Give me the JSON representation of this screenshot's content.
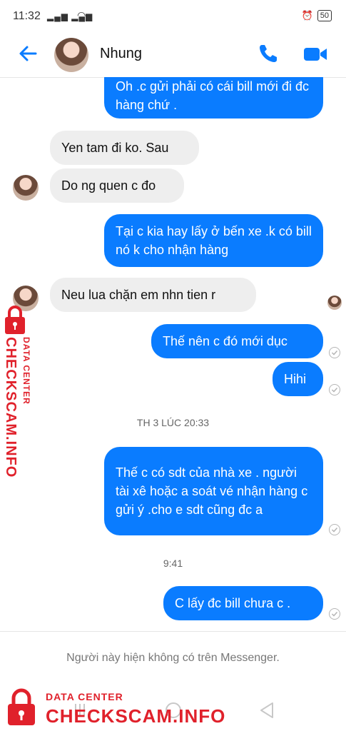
{
  "status_bar": {
    "time": "11:32",
    "battery": "50"
  },
  "header": {
    "contact_name": "Nhung"
  },
  "messages": [
    {
      "side": "out",
      "lines": "Oh .c gửi phải có cái bill mới đi đc hàng chứ ."
    },
    {
      "side": "in",
      "lines": "Yen tam đi ko. Sau"
    },
    {
      "side": "in",
      "lines": "Do ng quen c đo"
    },
    {
      "side": "out",
      "lines": "Tại c kia hay lấy ở bến xe .k có bill nó k cho nhận hàng"
    },
    {
      "side": "in",
      "lines": "Neu lua chặn em nhn tien r"
    },
    {
      "side": "out",
      "lines": "Thế nên c đó mới dục"
    },
    {
      "side": "out",
      "lines": "Hihi"
    },
    {
      "side": "out",
      "lines": "Thế c có sdt của nhà xe . người tài xê hoặc a soát vé nhận hàng c gửi ý .cho e sdt cũng đc a"
    },
    {
      "side": "out",
      "lines": "C lấy đc bill chưa c ."
    }
  ],
  "timestamps": [
    "TH 3 LÚC 20:33",
    "9:41"
  ],
  "footer_note": "Người này hiện không có trên Messenger.",
  "watermark": {
    "top_text": "DATA CENTER",
    "brand": "CHECKSCAM.INFO"
  },
  "colors": {
    "accent": "#0a7cff",
    "incoming_bubble": "#eeeeee",
    "watermark": "#e0212b"
  },
  "icons": [
    "back-arrow-icon",
    "phone-icon",
    "video-camera-icon",
    "seen-check-icon",
    "lock-icon",
    "wifi-icon",
    "signal-icon"
  ]
}
